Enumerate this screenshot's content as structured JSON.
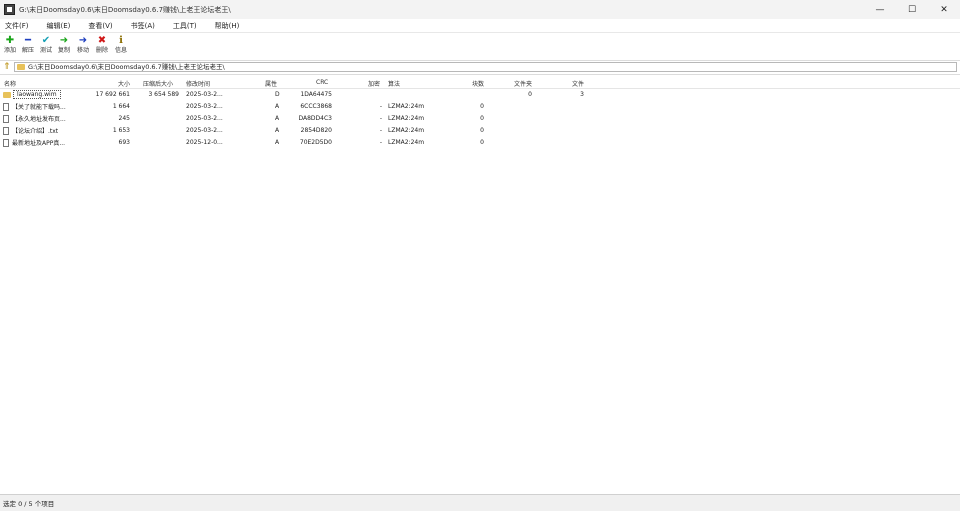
{
  "window": {
    "title": "G:\\末日Doomsday0.6\\末日Doomsday0.6.7赚钱\\上老王论坛老王\\",
    "minimize": "—",
    "maximize": "☐",
    "close": "✕"
  },
  "menu": [
    "文件(F)",
    "编辑(E)",
    "查看(V)",
    "书签(A)",
    "工具(T)",
    "帮助(H)"
  ],
  "toolbar": [
    {
      "label": "添加",
      "icon": "plus-icon",
      "glyph": "✚",
      "color": "#1aa51a"
    },
    {
      "label": "解压",
      "icon": "minus-icon",
      "glyph": "━",
      "color": "#1f3fbf"
    },
    {
      "label": "测试",
      "icon": "check-icon",
      "glyph": "✔",
      "color": "#16a0b5"
    },
    {
      "label": "复制",
      "icon": "arrow-right-icon",
      "glyph": "➜",
      "color": "#1aa51a"
    },
    {
      "label": "移动",
      "icon": "arrow-right-blue-icon",
      "glyph": "➜",
      "color": "#1f3fbf"
    },
    {
      "label": "删除",
      "icon": "delete-x-icon",
      "glyph": "✖",
      "color": "#d01818"
    },
    {
      "label": "信息",
      "icon": "info-icon",
      "glyph": "ℹ",
      "color": "#8a6d00"
    }
  ],
  "address": {
    "path": "G:\\末日Doomsday0.6\\末日Doomsday0.6.7赚钱\\上老王论坛老王\\",
    "up_glyph": "⇑"
  },
  "columns": [
    "名称",
    "大小",
    "压缩后大小",
    "修改时间",
    "属性",
    "CRC",
    "加密",
    "算法",
    "块数",
    "文件夹",
    "文件"
  ],
  "rows": [
    {
      "name": "laowang.wim",
      "type": "folder",
      "size": "17 692 661",
      "packed": "3 654 589",
      "modified": "2025-03-2...",
      "attr": "D",
      "crc": "1DA64475",
      "encrypted": "",
      "method": "",
      "blocks": "",
      "folders": "0",
      "files": "3",
      "selected": true
    },
    {
      "name": "【关了就能下载吗...",
      "type": "file",
      "size": "1 664",
      "packed": "",
      "modified": "2025-03-2...",
      "attr": "A",
      "crc": "6CCC3868",
      "encrypted": "-",
      "method": "LZMA2:24m",
      "blocks": "0",
      "folders": "",
      "files": "",
      "selected": false
    },
    {
      "name": "【永久地址发布页...",
      "type": "file",
      "size": "245",
      "packed": "",
      "modified": "2025-03-2...",
      "attr": "A",
      "crc": "DA8DD4C3",
      "encrypted": "-",
      "method": "LZMA2:24m",
      "blocks": "0",
      "folders": "",
      "files": "",
      "selected": false
    },
    {
      "name": "【论坛介绍】.txt",
      "type": "file",
      "size": "1 653",
      "packed": "",
      "modified": "2025-03-2...",
      "attr": "A",
      "crc": "2854D820",
      "encrypted": "-",
      "method": "LZMA2:24m",
      "blocks": "0",
      "folders": "",
      "files": "",
      "selected": false
    },
    {
      "name": "最新地址及APP真...",
      "type": "file",
      "size": "693",
      "packed": "",
      "modified": "2025-12-0...",
      "attr": "A",
      "crc": "70E2D5D0",
      "encrypted": "-",
      "method": "LZMA2:24m",
      "blocks": "0",
      "folders": "",
      "files": "",
      "selected": false
    }
  ],
  "status": {
    "text": "选定 0 / 5 个项目"
  }
}
